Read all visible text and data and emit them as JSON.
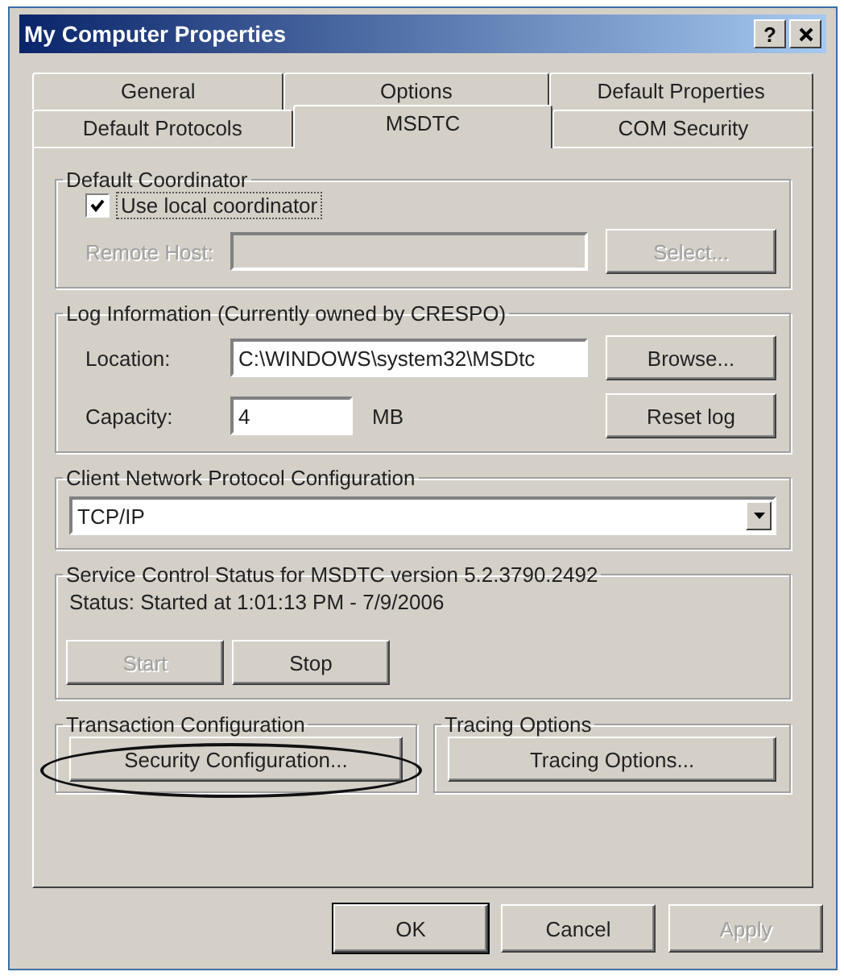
{
  "window": {
    "title": "My Computer Properties",
    "help": "?"
  },
  "tabs": [
    [
      {
        "label": "General",
        "selected": false
      },
      {
        "label": "Options",
        "selected": false
      },
      {
        "label": "Default Properties",
        "selected": false
      }
    ],
    [
      {
        "label": "Default Protocols",
        "selected": false
      },
      {
        "label": "MSDTC",
        "selected": true
      },
      {
        "label": "COM Security",
        "selected": false
      }
    ]
  ],
  "default_coordinator": {
    "title": "Default Coordinator",
    "checkbox": {
      "label": "Use local coordinator",
      "checked": true
    },
    "remote_host": {
      "label": "Remote Host:",
      "disabled": true
    },
    "select_button": {
      "label": "Select...",
      "disabled": true
    }
  },
  "log_information": {
    "title": "Log Information (Currently owned by CRESPO)",
    "location": {
      "label": "Location:",
      "value": "C:\\WINDOWS\\system32\\MSDtc"
    },
    "capacity": {
      "label": "Capacity:",
      "value": "4",
      "unit": "MB"
    },
    "buttons": [
      "Browse...",
      "Reset log"
    ]
  },
  "client_network": {
    "title": "Client Network Protocol Configuration",
    "value": "TCP/IP"
  },
  "service_control": {
    "title": "Service Control Status for MSDTC version 5.2.3790.2492",
    "status": "Status: Started at 1:01:13 PM - 7/9/2006",
    "buttons": [
      {
        "label": "Start",
        "disabled": true
      },
      {
        "label": "Stop",
        "disabled": false
      }
    ]
  },
  "transaction": {
    "title": "Transaction Configuration",
    "button": {
      "label": "Security Configuration...",
      "highlighted": true
    }
  },
  "tracing": {
    "title": "Tracing Options",
    "button": {
      "label": "Tracing Options...",
      "highlighted": false
    }
  },
  "dialog_buttons": [
    {
      "label": "OK",
      "disabled": false
    },
    {
      "label": "Cancel",
      "disabled": false
    },
    {
      "label": "Apply",
      "disabled": true
    }
  ]
}
